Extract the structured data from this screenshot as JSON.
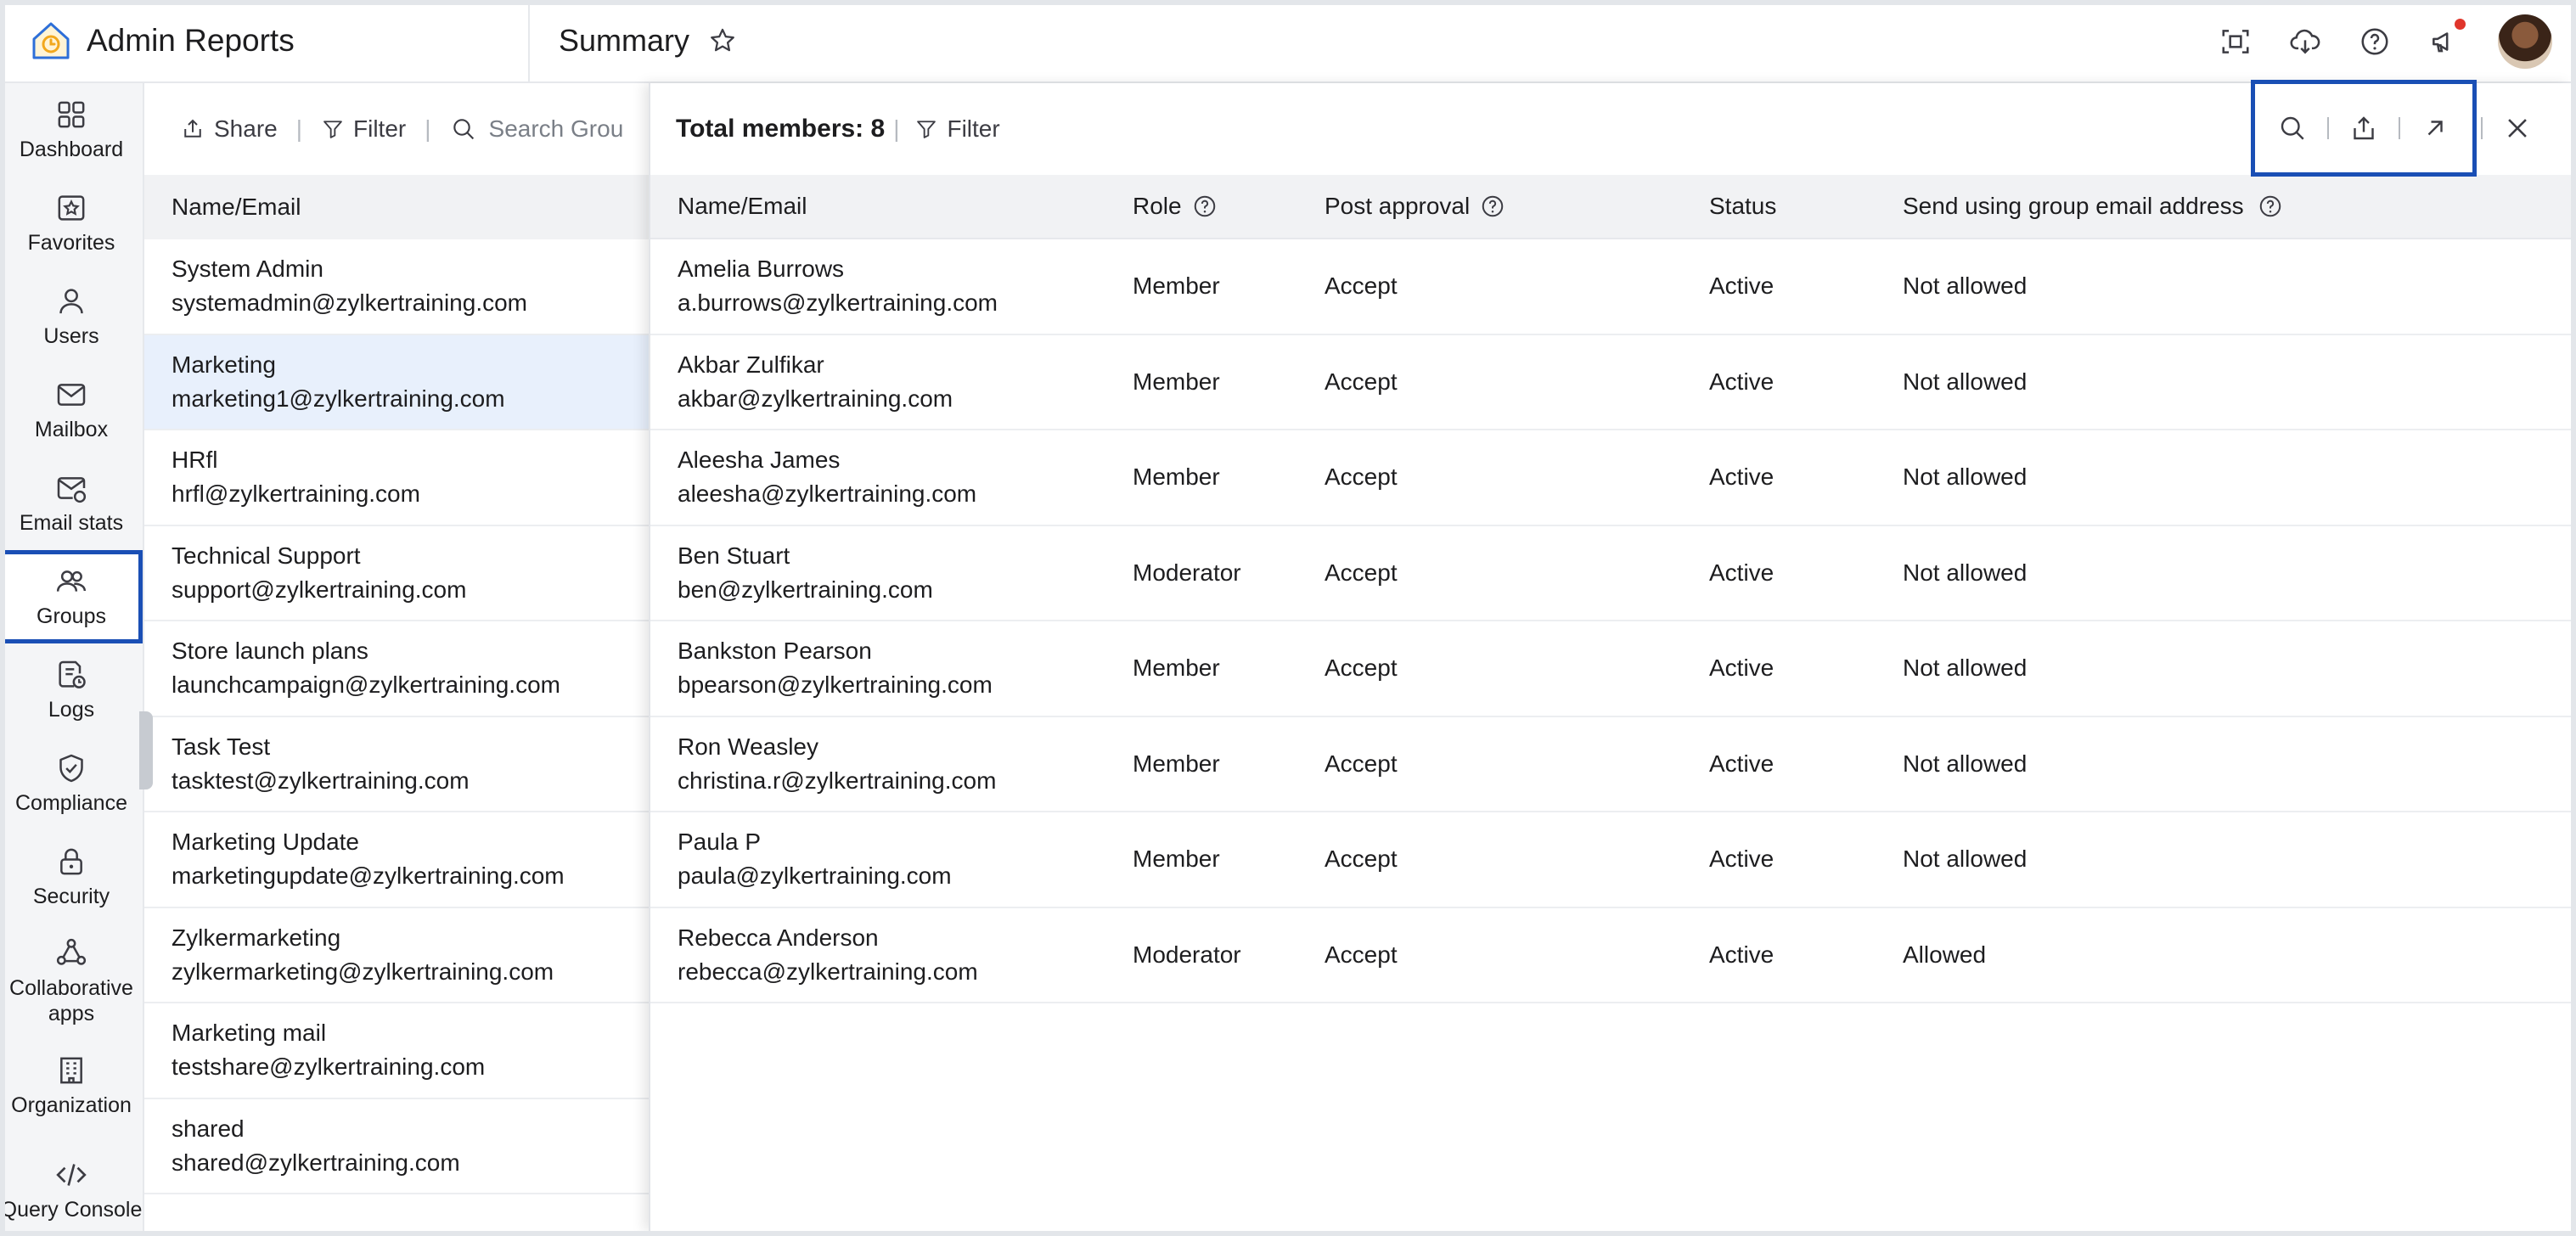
{
  "app": {
    "title": "Admin Reports"
  },
  "page": {
    "title": "Summary"
  },
  "nav": {
    "items": [
      {
        "label": "Dashboard",
        "icon": "dashboard-icon"
      },
      {
        "label": "Favorites",
        "icon": "favorites-icon"
      },
      {
        "label": "Users",
        "icon": "users-icon"
      },
      {
        "label": "Mailbox",
        "icon": "mailbox-icon"
      },
      {
        "label": "Email stats",
        "icon": "email-stats-icon"
      },
      {
        "label": "Groups",
        "icon": "groups-icon",
        "active": true
      },
      {
        "label": "Logs",
        "icon": "logs-icon"
      },
      {
        "label": "Compliance",
        "icon": "compliance-icon"
      },
      {
        "label": "Security",
        "icon": "security-icon"
      },
      {
        "label": "Collaborative apps",
        "icon": "collaborative-apps-icon"
      },
      {
        "label": "Organization",
        "icon": "organization-icon"
      },
      {
        "label": "Query Console",
        "icon": "query-console-icon"
      }
    ]
  },
  "groups_panel": {
    "share_label": "Share",
    "filter_label": "Filter",
    "search_placeholder": "Search Grou",
    "column_header": "Name/Email",
    "rows": [
      {
        "name": "System Admin",
        "email": "systemadmin@zylkertraining.com"
      },
      {
        "name": "Marketing",
        "email": "marketing1@zylkertraining.com",
        "selected": true
      },
      {
        "name": "HRfl",
        "email": "hrfl@zylkertraining.com"
      },
      {
        "name": "Technical Support",
        "email": "support@zylkertraining.com"
      },
      {
        "name": "Store launch plans",
        "email": "launchcampaign@zylkertraining.com"
      },
      {
        "name": "Task Test",
        "email": "tasktest@zylkertraining.com"
      },
      {
        "name": "Marketing Update",
        "email": "marketingupdate@zylkertraining.com"
      },
      {
        "name": "Zylkermarketing",
        "email": "zylkermarketing@zylkertraining.com"
      },
      {
        "name": "Marketing mail",
        "email": "testshare@zylkertraining.com"
      },
      {
        "name": "shared",
        "email": "shared@zylkertraining.com"
      }
    ]
  },
  "members_panel": {
    "total_label": "Total members: 8",
    "filter_label": "Filter",
    "columns": {
      "name": "Name/Email",
      "role": "Role",
      "post_approval": "Post approval",
      "status": "Status",
      "send_using": "Send using group email address"
    },
    "rows": [
      {
        "name": "Amelia Burrows",
        "email": "a.burrows@zylkertraining.com",
        "role": "Member",
        "post_approval": "Accept",
        "status": "Active",
        "send": "Not allowed"
      },
      {
        "name": "Akbar Zulfikar",
        "email": "akbar@zylkertraining.com",
        "role": "Member",
        "post_approval": "Accept",
        "status": "Active",
        "send": "Not allowed"
      },
      {
        "name": "Aleesha James",
        "email": "aleesha@zylkertraining.com",
        "role": "Member",
        "post_approval": "Accept",
        "status": "Active",
        "send": "Not allowed"
      },
      {
        "name": "Ben Stuart",
        "email": "ben@zylkertraining.com",
        "role": "Moderator",
        "post_approval": "Accept",
        "status": "Active",
        "send": "Not allowed"
      },
      {
        "name": "Bankston Pearson",
        "email": "bpearson@zylkertraining.com",
        "role": "Member",
        "post_approval": "Accept",
        "status": "Active",
        "send": "Not allowed"
      },
      {
        "name": "Ron Weasley",
        "email": "christina.r@zylkertraining.com",
        "role": "Member",
        "post_approval": "Accept",
        "status": "Active",
        "send": "Not allowed"
      },
      {
        "name": "Paula P",
        "email": "paula@zylkertraining.com",
        "role": "Member",
        "post_approval": "Accept",
        "status": "Active",
        "send": "Not allowed"
      },
      {
        "name": "Rebecca Anderson",
        "email": "rebecca@zylkertraining.com",
        "role": "Moderator",
        "post_approval": "Accept",
        "status": "Active",
        "send": "Allowed"
      }
    ]
  },
  "colors": {
    "accent": "#1a4fb5",
    "selected_row": "#e8f0fc",
    "header_bg": "#f1f2f4",
    "notification": "#e0352b"
  }
}
